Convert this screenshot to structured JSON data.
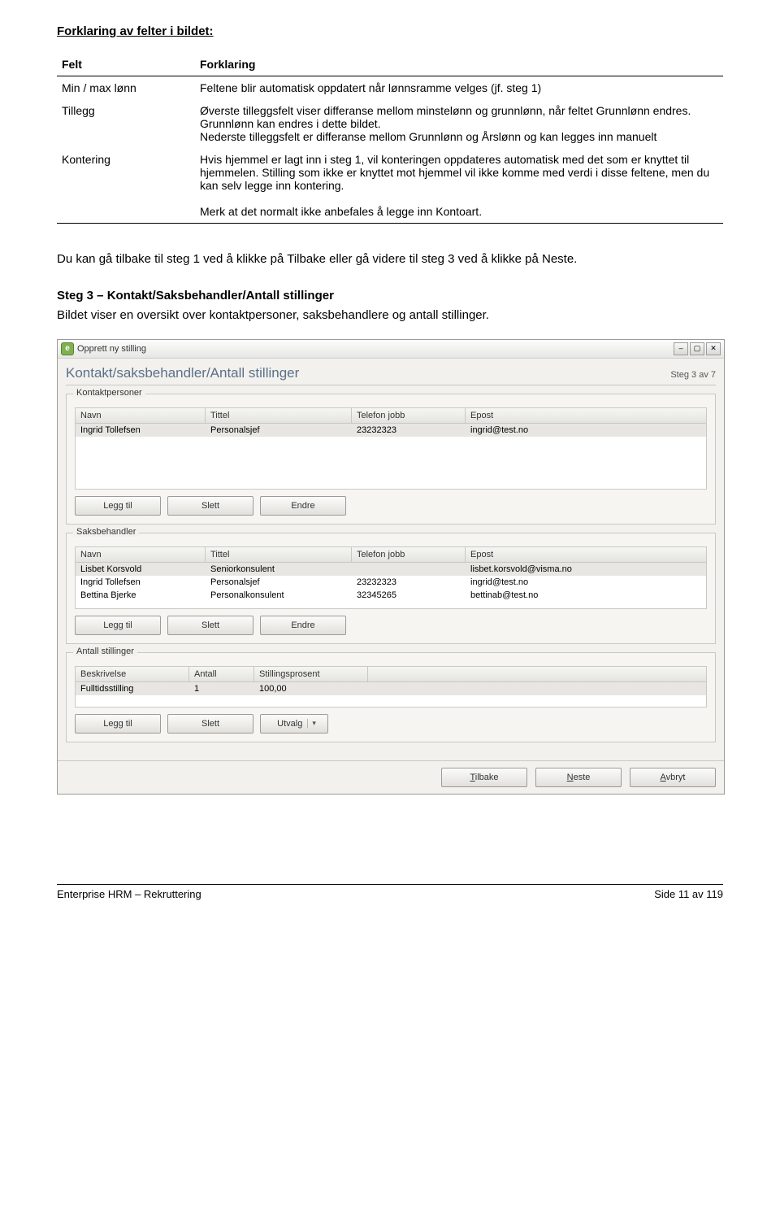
{
  "intro_heading": "Forklaring av felter i bildet:",
  "table": {
    "head_felt": "Felt",
    "head_forklaring": "Forklaring",
    "rows": [
      {
        "felt": "Min / max lønn",
        "forklaring": "Feltene blir automatisk oppdatert når lønnsramme velges (jf. steg 1)"
      },
      {
        "felt": "Tillegg",
        "forklaring": "Øverste tilleggsfelt viser differanse mellom minstelønn og grunnlønn, når feltet Grunnlønn endres. Grunnlønn kan endres i dette bildet.\nNederste tilleggsfelt er differanse mellom Grunnlønn og Årslønn og kan legges inn manuelt"
      },
      {
        "felt": "Kontering",
        "forklaring": "Hvis hjemmel er lagt inn i steg 1, vil konteringen oppdateres automatisk med det som er knyttet til hjemmelen. Stilling som ikke er knyttet mot hjemmel vil ikke komme med verdi i disse feltene, men du kan selv legge inn kontering.\n\nMerk at det normalt ikke anbefales å legge inn Kontoart."
      }
    ]
  },
  "body_p1": "Du kan gå tilbake til steg 1 ved å klikke på Tilbake eller gå videre til steg 3 ved å klikke på Neste.",
  "step3_title": "Steg 3 – Kontakt/Saksbehandler/Antall stillinger",
  "step3_p": "Bildet viser en oversikt over kontaktpersoner, saksbehandlere og antall stillinger.",
  "window": {
    "title": "Opprett ny stilling",
    "form_title": "Kontakt/saksbehandler/Antall stillinger",
    "step_label": "Steg 3 av 7",
    "groups": {
      "kontakt": {
        "legend": "Kontaktpersoner",
        "cols": {
          "navn": "Navn",
          "tittel": "Tittel",
          "tlf": "Telefon jobb",
          "epost": "Epost"
        },
        "rows": [
          {
            "navn": "Ingrid Tollefsen",
            "tittel": "Personalsjef",
            "tlf": "23232323",
            "epost": "ingrid@test.no"
          }
        ]
      },
      "saks": {
        "legend": "Saksbehandler",
        "cols": {
          "navn": "Navn",
          "tittel": "Tittel",
          "tlf": "Telefon jobb",
          "epost": "Epost"
        },
        "rows": [
          {
            "navn": "Lisbet Korsvold",
            "tittel": "Seniorkonsulent",
            "tlf": "",
            "epost": "lisbet.korsvold@visma.no"
          },
          {
            "navn": "Ingrid Tollefsen",
            "tittel": "Personalsjef",
            "tlf": "23232323",
            "epost": "ingrid@test.no"
          },
          {
            "navn": "Bettina Bjerke",
            "tittel": "Personalkonsulent",
            "tlf": "32345265",
            "epost": "bettinab@test.no"
          }
        ]
      },
      "antall": {
        "legend": "Antall stillinger",
        "cols": {
          "besk": "Beskrivelse",
          "antall": "Antall",
          "pros": "Stillingsprosent"
        },
        "rows": [
          {
            "besk": "Fulltidsstilling",
            "antall": "1",
            "pros": "100,00"
          }
        ]
      }
    },
    "buttons": {
      "leggtil": "Legg til",
      "slett": "Slett",
      "endre": "Endre",
      "utvalg": "Utvalg",
      "tilbake": "Tilbake",
      "neste": "Neste",
      "avbryt": "Avbryt"
    }
  },
  "footer": {
    "left": "Enterprise HRM – Rekruttering",
    "right": "Side 11 av 119"
  }
}
